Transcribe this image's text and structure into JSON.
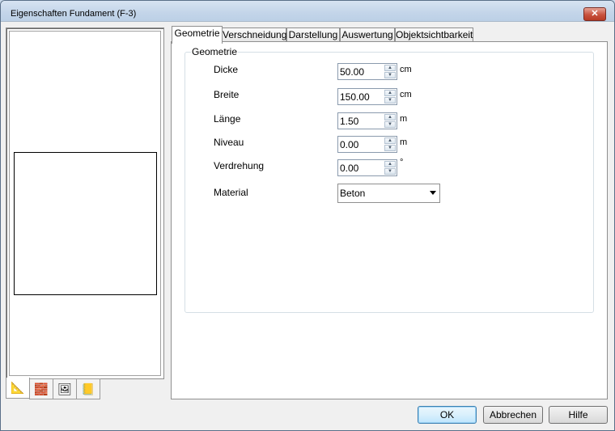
{
  "window": {
    "title": "Eigenschaften Fundament (F-3)",
    "close_glyph": "✕"
  },
  "icon_tabs": [
    {
      "name": "drawing-tool-icon",
      "glyph": "📐"
    },
    {
      "name": "blocks-icon",
      "glyph": "🧱"
    },
    {
      "name": "image-icon",
      "glyph": "🖼"
    },
    {
      "name": "note-icon",
      "glyph": "📒"
    }
  ],
  "tabs": [
    "Geometrie",
    "Verschneidung",
    "Darstellung",
    "Auswertung",
    "Objektsichtbarkeit"
  ],
  "group": {
    "label": "Geometrie",
    "fields": [
      {
        "label": "Dicke",
        "value": "50.00",
        "unit": "cm"
      },
      {
        "label": "Breite",
        "value": "150.00",
        "unit": "cm"
      },
      {
        "label": "Länge",
        "value": "1.50",
        "unit": "m"
      },
      {
        "label": "Niveau",
        "value": "0.00",
        "unit": "m"
      },
      {
        "label": "Verdrehung",
        "value": "0.00",
        "unit": "°"
      }
    ],
    "material": {
      "label": "Material",
      "value": "Beton"
    }
  },
  "buttons": {
    "ok": "OK",
    "cancel": "Abbrechen",
    "help": "Hilfe"
  }
}
